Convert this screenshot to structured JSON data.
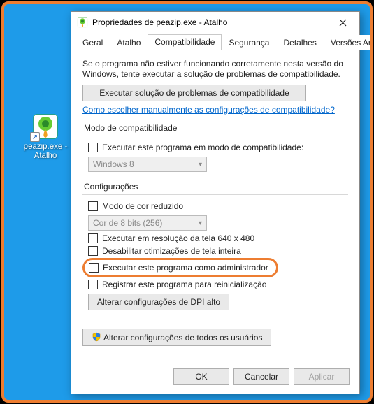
{
  "desktop": {
    "icon_label": "peazip.exe - Atalho"
  },
  "window": {
    "title": "Propriedades de peazip.exe - Atalho"
  },
  "tabs": {
    "items": [
      {
        "label": "Geral"
      },
      {
        "label": "Atalho"
      },
      {
        "label": "Compatibilidade"
      },
      {
        "label": "Segurança"
      },
      {
        "label": "Detalhes"
      },
      {
        "label": "Versões Anteriores"
      }
    ],
    "active_index": 2
  },
  "content": {
    "intro": "Se o programa não estiver funcionando corretamente nesta versão do Windows, tente executar a solução de problemas de compatibilidade.",
    "troubleshoot_btn": "Executar solução de problemas de compatibilidade",
    "manual_link": "Como escolher manualmente as configurações de compatibilidade?",
    "compat_group_title": "Modo de compatibilidade",
    "compat_check": "Executar este programa em modo de compatibilidade:",
    "compat_select": "Windows 8",
    "settings_group_title": "Configurações",
    "reduced_color": "Modo de cor reduzido",
    "color_select": "Cor de 8 bits (256)",
    "res640": "Executar em resolução da tela 640 x 480",
    "disable_fullscreen": "Desabilitar otimizações de tela inteira",
    "run_admin": "Executar este programa como administrador",
    "register_restart": "Registrar este programa para reinicialização",
    "dpi_btn": "Alterar configurações de DPI alto",
    "all_users_btn": "Alterar configurações de todos os usuários"
  },
  "footer": {
    "ok": "OK",
    "cancel": "Cancelar",
    "apply": "Aplicar"
  }
}
